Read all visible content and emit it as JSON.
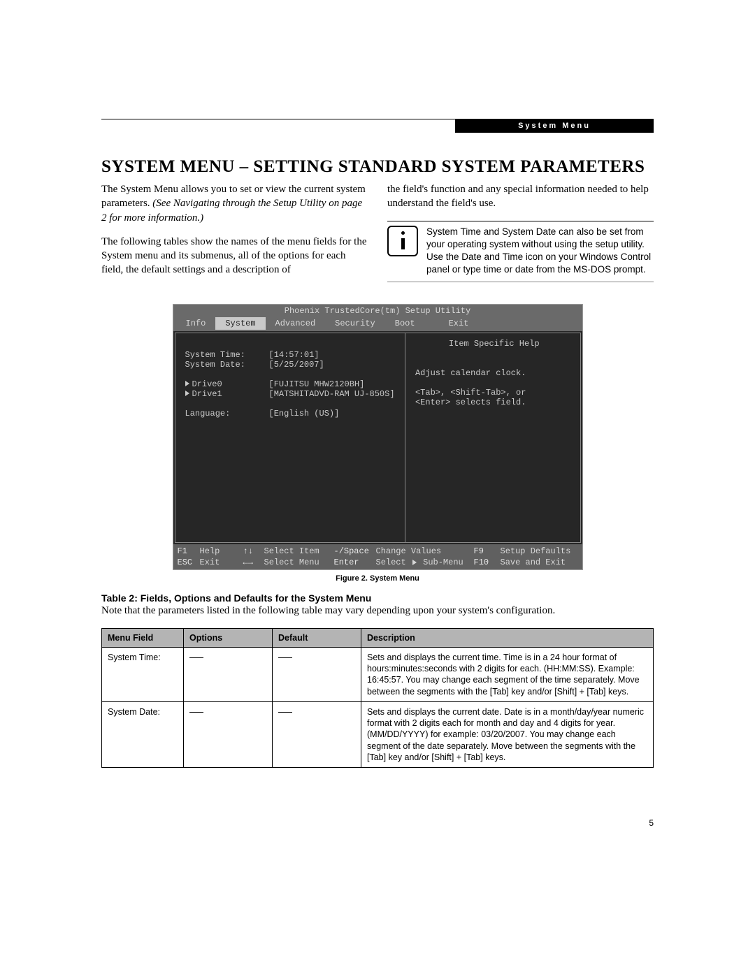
{
  "header_label": "System Menu",
  "title": "SYSTEM MENU – SETTING STANDARD SYSTEM PARAMETERS",
  "col1": {
    "p1a": "The System Menu allows you to set or view the current system parameters. ",
    "p1b": "(See Navigating through the Setup Utility on page 2 for more information.)",
    "p2": "The following tables show the names of the menu fields for the System menu and its submenus, all of the options for each field, the default settings and a description of"
  },
  "col2": {
    "p1": "the field's function and any special information needed to help understand the field's use.",
    "note": "System Time and System Date can also be set from your operating system without using the setup utility. Use the Date and Time icon on your Windows Control panel or type time or date from the MS-DOS prompt."
  },
  "bios": {
    "title": "Phoenix TrustedCore(tm) Setup Utility",
    "tabs": [
      "Info",
      "System",
      "Advanced",
      "Security",
      "Boot",
      "Exit"
    ],
    "active_tab": "System",
    "fields": {
      "system_time_label": "System Time:",
      "system_time_val": "[14:57:01]",
      "system_date_label": "System Date:",
      "system_date_val": "[5/25/2007]",
      "drive0_label": "Drive0",
      "drive0_val": "[FUJITSU MHW2120BH]",
      "drive1_label": "Drive1",
      "drive1_val": "[MATSHITADVD-RAM UJ-850S]",
      "language_label": "Language:",
      "language_val": "[English (US)]"
    },
    "help": {
      "title": "Item Specific Help",
      "line1": "Adjust calendar clock.",
      "line2": "<Tab>, <Shift-Tab>, or",
      "line3": "<Enter> selects field."
    },
    "footer": {
      "r1": {
        "k1": "F1",
        "l1": "Help",
        "k2": "↑↓",
        "l2": "Select Item",
        "k3": "-/Space",
        "l3": "Change Values",
        "k4": "F9",
        "l4": "Setup Defaults"
      },
      "r2": {
        "k1": "ESC",
        "l1": "Exit",
        "k2": "←→",
        "l2": "Select Menu",
        "k3": "Enter",
        "l3": "Select ▶ Sub-Menu",
        "k4": "F10",
        "l4": "Save and Exit"
      }
    }
  },
  "figure_caption": "Figure 2.  System Menu",
  "table_title": "Table 2: Fields, Options and Defaults for the System Menu",
  "table_note": "Note that the parameters listed in the following table may vary depending upon your system's configuration.",
  "table": {
    "headers": [
      "Menu Field",
      "Options",
      "Default",
      "Description"
    ],
    "rows": [
      {
        "field": "System Time:",
        "options": "—",
        "default": "—",
        "desc": "Sets and displays the current time. Time is in a 24 hour format of hours:minutes:seconds with 2 digits for each. (HH:MM:SS). Example: 16:45:57. You may change each segment of the time separately. Move between the segments with the [Tab] key and/or [Shift] + [Tab] keys."
      },
      {
        "field": "System Date:",
        "options": "—",
        "default": "—",
        "desc": "Sets and displays the current date. Date is in a month/day/year numeric format with 2 digits each for month and day and 4 digits for year. (MM/DD/YYYY) for example: 03/20/2007. You may change each segment of the date separately. Move between the segments with the [Tab] key and/or [Shift] + [Tab] keys."
      }
    ]
  },
  "page_number": "5"
}
